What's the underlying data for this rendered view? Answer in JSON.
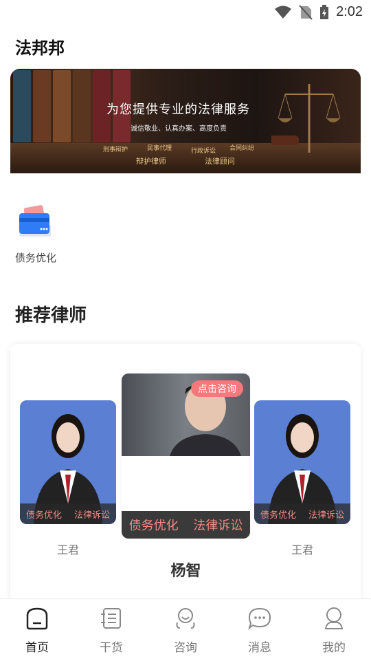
{
  "status": {
    "time": "2:02"
  },
  "app": {
    "title": "法邦邦"
  },
  "banner": {
    "headline": "为您提供专业的法律服务",
    "subline": "诚信敬业、认真办案、高度负责",
    "tags": [
      "刑事辩护",
      "民事代理",
      "行政诉讼",
      "合同纠纷"
    ],
    "big_tags": [
      "辩护律师",
      "法律顾问"
    ]
  },
  "quick_menu": {
    "items": [
      {
        "label": "债务优化",
        "icon": "card-icon"
      }
    ]
  },
  "section": {
    "title": "推荐律师"
  },
  "lawyers": {
    "left": {
      "name": "王君",
      "tags": [
        "债务优化",
        "法律诉讼"
      ]
    },
    "center": {
      "name": "杨智",
      "tags": [
        "债务优化",
        "法律诉讼"
      ],
      "consult_label": "点击咨询"
    },
    "right": {
      "name": "王君",
      "tags": [
        "债务优化",
        "法律诉讼"
      ]
    }
  },
  "nav": {
    "items": [
      {
        "label": "首页",
        "icon": "home-icon",
        "active": true
      },
      {
        "label": "干货",
        "icon": "list-icon",
        "active": false
      },
      {
        "label": "咨询",
        "icon": "consult-icon",
        "active": false
      },
      {
        "label": "消息",
        "icon": "message-icon",
        "active": false
      },
      {
        "label": "我的",
        "icon": "profile-icon",
        "active": false
      }
    ]
  },
  "colors": {
    "accent": "#f4787c",
    "tag_text": "#f08a85",
    "card_blue": "#5b7fd3"
  }
}
